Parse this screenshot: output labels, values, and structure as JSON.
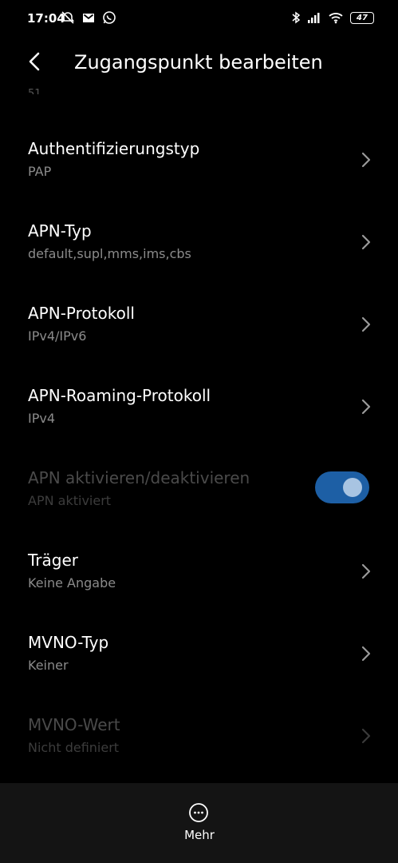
{
  "status_bar": {
    "time": "17:04",
    "battery": "47",
    "left_icons": [
      "alarm-off-icon",
      "gmail-icon",
      "whatsapp-icon"
    ],
    "right_icons": [
      "bluetooth-icon",
      "signal-icon",
      "wifi-icon",
      "battery-icon"
    ]
  },
  "header": {
    "title": "Zugangspunkt bearbeiten",
    "back_icon": "back-arrow-icon"
  },
  "cut_off_value": "51",
  "items": [
    {
      "title": "Authentifizierungstyp",
      "subtitle": "PAP"
    },
    {
      "title": "APN-Typ",
      "subtitle": "default,supl,mms,ims,cbs"
    },
    {
      "title": "APN-Protokoll",
      "subtitle": "IPv4/IPv6"
    },
    {
      "title": "APN-Roaming-Protokoll",
      "subtitle": "IPv4"
    },
    {
      "title": "APN aktivieren/deaktivieren",
      "subtitle": "APN aktiviert",
      "toggle_on": true
    },
    {
      "title": "Träger",
      "subtitle": "Keine Angabe"
    },
    {
      "title": "MVNO-Typ",
      "subtitle": "Keiner"
    },
    {
      "title": "MVNO-Wert",
      "subtitle": "Nicht definiert"
    }
  ],
  "bottom_bar": {
    "more_label": "Mehr",
    "more_icon": "more-circle-icon"
  },
  "colors": {
    "background": "#000000",
    "toggle_track": "#1d5fa5",
    "toggle_knob": "#a8c4e2",
    "subtitle": "#8b8b8b",
    "bottom_bar": "#141414"
  }
}
